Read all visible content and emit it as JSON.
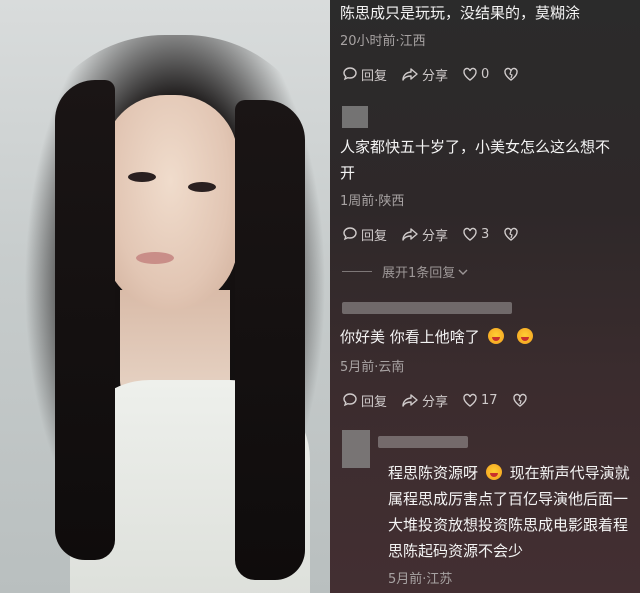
{
  "comments": [
    {
      "text": "陈思成只是玩玩，没结果的，莫糊涂",
      "meta": "20小时前·江西",
      "reply_label": "回复",
      "share_label": "分享",
      "likes": "0"
    },
    {
      "text_line1": "人家都快五十岁了，小美女怎么这么想不",
      "text_line2": "开",
      "meta": "1周前·陕西",
      "reply_label": "回复",
      "share_label": "分享",
      "likes": "3",
      "expand_label": "展开1条回复"
    },
    {
      "text": "你好美 你看上他啥了",
      "meta": "5月前·云南",
      "reply_label": "回复",
      "share_label": "分享",
      "likes": "17"
    },
    {
      "text_line1_a": "程思陈资源呀",
      "text_line1_b": "现在新声代导演就",
      "text_line2": "属程思成厉害点了百亿导演他后面一",
      "text_line3": "大堆投资放想投资陈思成电影跟着程",
      "text_line4": "思陈起码资源不会少",
      "meta": "5月前·江苏"
    }
  ],
  "icons": {
    "reply": "speech-bubble-icon",
    "share": "share-arrow-icon",
    "like": "heart-icon",
    "dislike": "broken-heart-icon",
    "emoji": "laughing-emoji-icon"
  }
}
